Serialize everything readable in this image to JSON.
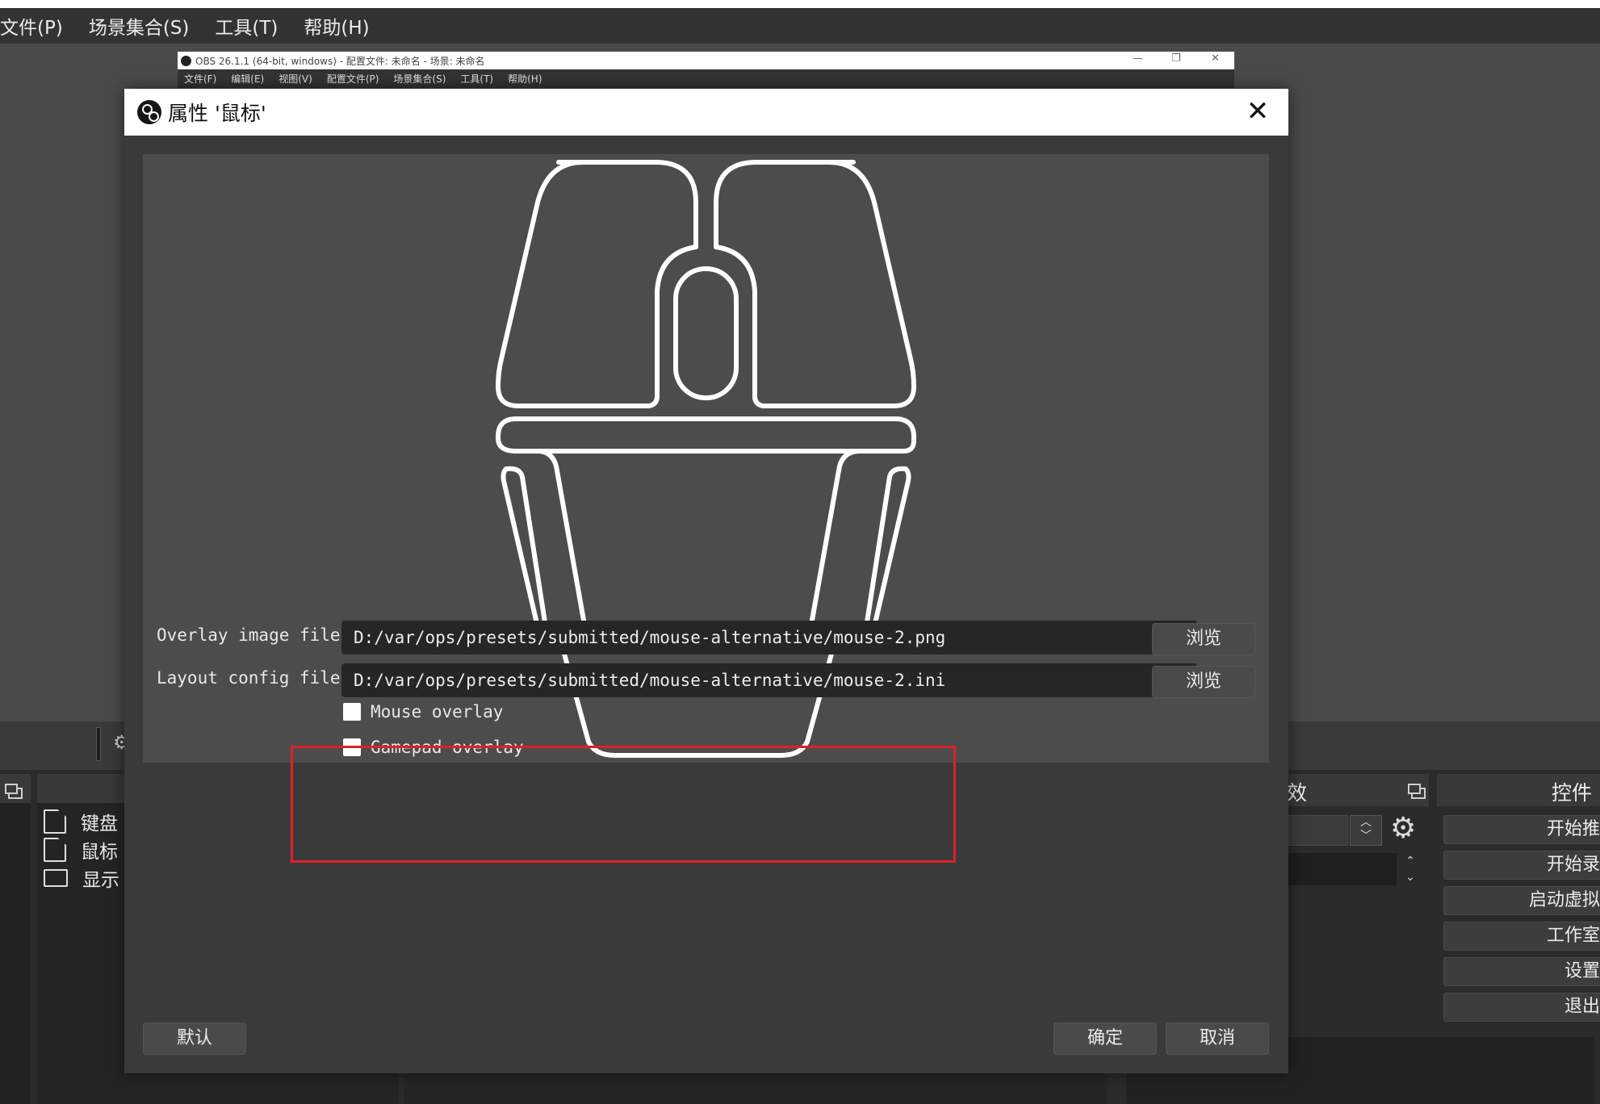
{
  "background": {
    "menu": [
      "文件(P)",
      "场景集合(S)",
      "工具(T)",
      "帮助(H)"
    ],
    "sources": [
      {
        "label": "键盘",
        "icon": "file-icon"
      },
      {
        "label": "鼠标",
        "icon": "file-icon"
      },
      {
        "label": "显示",
        "icon": "monitor-icon"
      }
    ],
    "filters_label": "效",
    "controls_label": "控件",
    "controls": [
      "开始推",
      "开始录",
      "启动虚拟",
      "工作室",
      "设置",
      "退出"
    ]
  },
  "inner_window": {
    "title": "OBS 26.1.1 (64-bit, windows) - 配置文件: 未命名 - 场景: 未命名",
    "menu": [
      "文件(F)",
      "编辑(E)",
      "视图(V)",
      "配置文件(P)",
      "场景集合(S)",
      "工具(T)",
      "帮助(H)"
    ]
  },
  "dialog": {
    "title": "属性 '鼠标'",
    "overlay_label": "Overlay image file",
    "overlay_value": "D:/var/ops/presets/submitted/mouse-alternative/mouse-2.png",
    "layout_label": "Layout config file",
    "layout_value": "D:/var/ops/presets/submitted/mouse-alternative/mouse-2.ini",
    "browse_label": "浏览",
    "mouse_overlay_label": "Mouse overlay",
    "gamepad_overlay_label": "Gamepad overlay",
    "mouse_overlay_checked": false,
    "gamepad_overlay_checked": false,
    "defaults_button": "默认",
    "ok_button": "确定",
    "cancel_button": "取消"
  },
  "colors": {
    "highlight": "#e0202a",
    "dialog_bg": "#3a3a3a",
    "preview_bg": "#4c4c4c"
  }
}
